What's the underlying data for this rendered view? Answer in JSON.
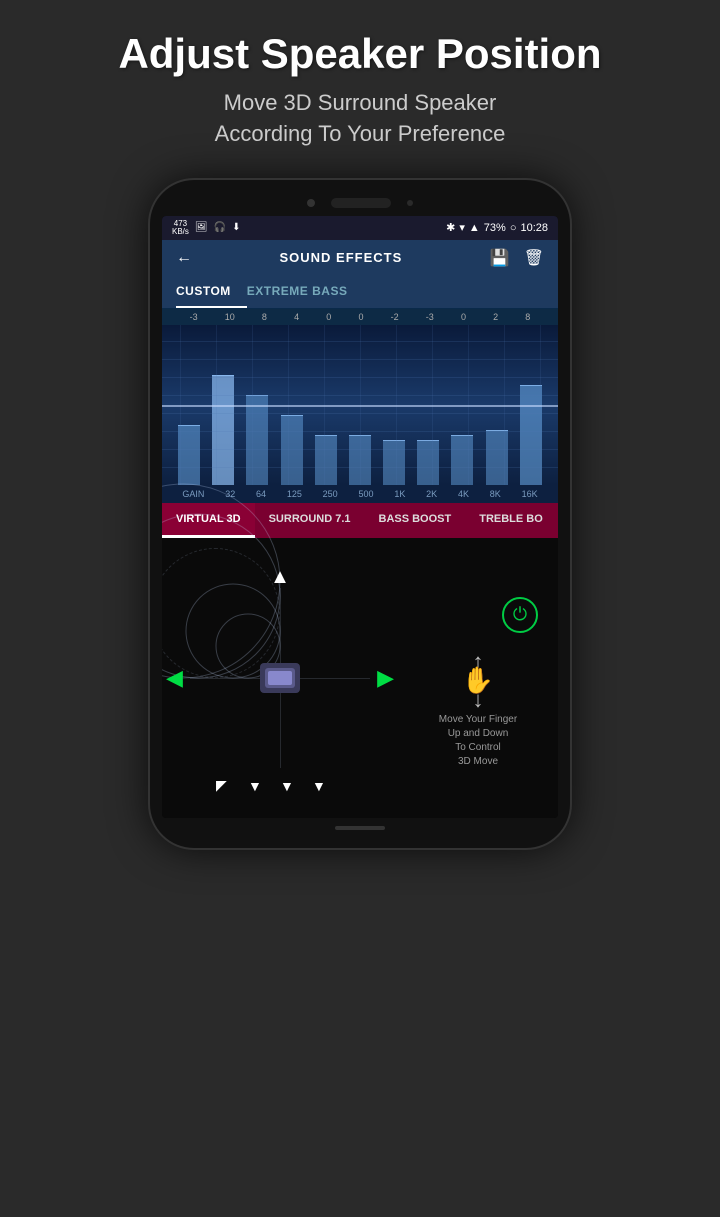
{
  "header": {
    "title": "Adjust Speaker Position",
    "subtitle_line1": "Move 3D Surround Speaker",
    "subtitle_line2": "According To Your Preference"
  },
  "status_bar": {
    "speed": "473",
    "speed_unit": "KB/s",
    "battery": "73%",
    "time": "10:28"
  },
  "nav": {
    "title": "SOUND EFFECTS",
    "back_label": "←",
    "save_icon": "💾",
    "delete_icon": "🗑"
  },
  "tabs": [
    {
      "label": "CUSTOM",
      "active": true
    },
    {
      "label": "EXTREME BASS",
      "active": false
    }
  ],
  "eq": {
    "numbers": [
      "-3",
      "10",
      "8",
      "4",
      "0",
      "0",
      "-2",
      "-3",
      "0",
      "2",
      "8"
    ],
    "labels": [
      "GAIN",
      "32",
      "64",
      "125",
      "250",
      "500",
      "1K",
      "2K",
      "4K",
      "8K",
      "16K"
    ],
    "bars": [
      {
        "height": 60,
        "highlight": true
      },
      {
        "height": 110,
        "highlight": true
      },
      {
        "height": 90,
        "highlight": false
      },
      {
        "height": 70,
        "highlight": false
      },
      {
        "height": 50,
        "highlight": false
      },
      {
        "height": 50,
        "highlight": false
      },
      {
        "height": 45,
        "highlight": false
      },
      {
        "height": 45,
        "highlight": false
      },
      {
        "height": 50,
        "highlight": false
      },
      {
        "height": 55,
        "highlight": true
      },
      {
        "height": 100,
        "highlight": true
      }
    ]
  },
  "bottom_tabs": [
    {
      "label": "VIRTUAL 3D",
      "active": true
    },
    {
      "label": "SURROUND 7.1",
      "active": false
    },
    {
      "label": "BASS BOOST",
      "active": false
    },
    {
      "label": "TREBLE BO",
      "active": false
    }
  ],
  "virtual3d": {
    "gesture_text": "Move Your Finger\nUp and Down\nTo Control\n3D Move"
  }
}
